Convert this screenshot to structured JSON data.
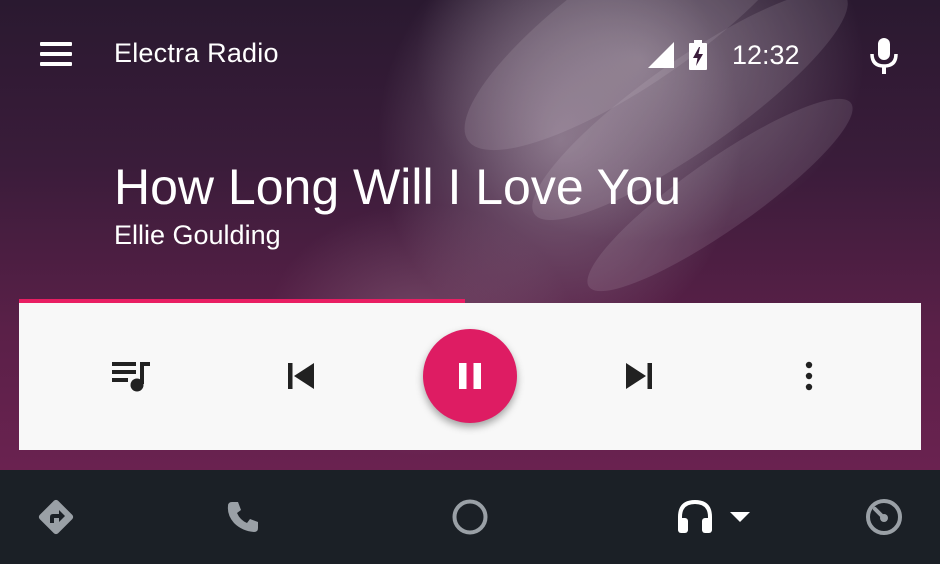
{
  "header": {
    "app_title": "Electra Radio",
    "time": "12:32",
    "icons": [
      "menu-icon",
      "cell-signal-icon",
      "battery-charging-icon",
      "microphone-icon"
    ]
  },
  "now_playing": {
    "title": "How Long Will I Love You",
    "artist": "Ellie Goulding",
    "progress_fraction": 0.495
  },
  "controls": {
    "icons": [
      "queue-music-icon",
      "skip-previous-icon",
      "pause-icon",
      "skip-next-icon",
      "more-vert-icon"
    ]
  },
  "bottom_nav": {
    "icons": [
      "navigation-icon",
      "phone-icon",
      "home-circle-icon",
      "headphones-icon",
      "dropdown-arrow-icon",
      "dashboard-icon"
    ]
  },
  "colors": {
    "accent": "#e91e63",
    "card": "#f8f8f8",
    "nav_bg": "#1b2026",
    "nav_icon": "#9aa0a6"
  }
}
